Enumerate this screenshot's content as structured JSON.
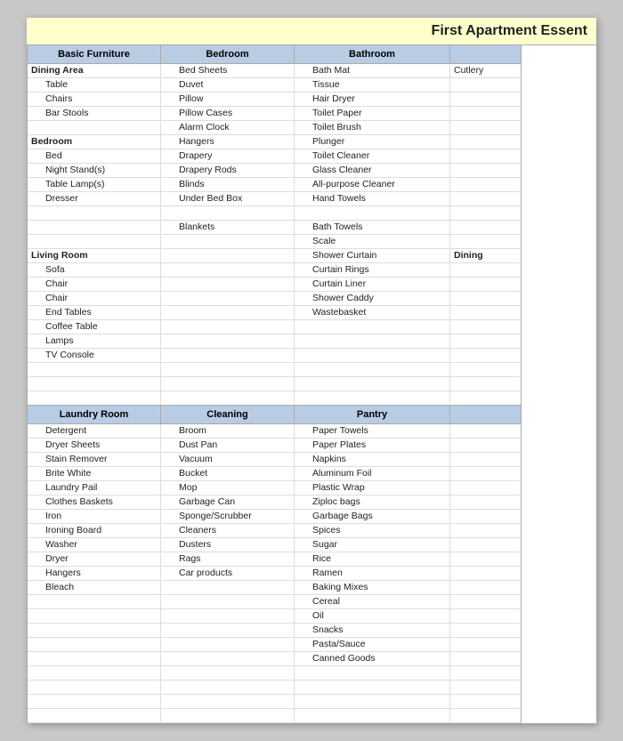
{
  "title": "First Apartment Essent",
  "columns": [
    "Basic Furniture",
    "Bedroom",
    "Bathroom",
    ""
  ],
  "col4_label": "Cutlery",
  "rows": [
    [
      "Dining Area",
      "Bed Sheets",
      "Bath Mat",
      "Cutlery"
    ],
    [
      "   Table",
      "Duvet",
      "Tissue",
      ""
    ],
    [
      "   Chairs",
      "Pillow",
      "Hair Dryer",
      ""
    ],
    [
      "   Bar Stools",
      "Pillow Cases",
      "Toilet Paper",
      ""
    ],
    [
      "",
      "Alarm Clock",
      "Toilet Brush",
      ""
    ],
    [
      "Bedroom",
      "Hangers",
      "Plunger",
      ""
    ],
    [
      "   Bed",
      "Drapery",
      "Toilet Cleaner",
      ""
    ],
    [
      "   Night Stand(s)",
      "Drapery Rods",
      "Glass Cleaner",
      ""
    ],
    [
      "   Table Lamp(s)",
      "Blinds",
      "All-purpose Cleaner",
      ""
    ],
    [
      "   Dresser",
      "Under Bed Box",
      "Hand Towels",
      ""
    ],
    [
      "",
      "",
      "",
      ""
    ],
    [
      "",
      "Blankets",
      "Bath Towels",
      ""
    ],
    [
      "",
      "",
      "Scale",
      ""
    ],
    [
      "Living Room",
      "",
      "Shower Curtain",
      "Dining"
    ],
    [
      "   Sofa",
      "",
      "Curtain Rings",
      ""
    ],
    [
      "   Chair",
      "",
      "Curtain Liner",
      ""
    ],
    [
      "   Chair",
      "",
      "Shower Caddy",
      ""
    ],
    [
      "   End Tables",
      "",
      "Wastebasket",
      ""
    ],
    [
      "   Coffee Table",
      "",
      "",
      ""
    ],
    [
      "   Lamps",
      "",
      "",
      ""
    ],
    [
      "   TV Console",
      "",
      "",
      ""
    ],
    [
      "",
      "",
      "",
      ""
    ],
    [
      "",
      "",
      "",
      ""
    ],
    [
      "",
      "",
      "",
      ""
    ],
    [
      "",
      "",
      "",
      ""
    ]
  ],
  "section2_headers": [
    "Laundry Room",
    "Cleaning",
    "Pantry",
    ""
  ],
  "rows2": [
    [
      "Detergent",
      "Broom",
      "Paper Towels",
      ""
    ],
    [
      "Dryer Sheets",
      "Dust Pan",
      "Paper Plates",
      ""
    ],
    [
      "Stain Remover",
      "Vacuum",
      "Napkins",
      ""
    ],
    [
      "Brite White",
      "Bucket",
      "Aluminum Foil",
      ""
    ],
    [
      "Laundry Pail",
      "Mop",
      "Plastic Wrap",
      ""
    ],
    [
      "Clothes Baskets",
      "Garbage Can",
      "Ziploc bags",
      ""
    ],
    [
      "Iron",
      "Sponge/Scrubber",
      "Garbage Bags",
      ""
    ],
    [
      "Ironing Board",
      "Cleaners",
      "Spices",
      ""
    ],
    [
      "Washer",
      "Dusters",
      "Sugar",
      ""
    ],
    [
      "Dryer",
      "Rags",
      "Rice",
      ""
    ],
    [
      "Hangers",
      "Car products",
      "Ramen",
      ""
    ],
    [
      "Bleach",
      "",
      "Baking Mixes",
      ""
    ],
    [
      "",
      "",
      "Cereal",
      ""
    ],
    [
      "",
      "",
      "Oil",
      ""
    ],
    [
      "",
      "",
      "Snacks",
      ""
    ],
    [
      "",
      "",
      "Pasta/Sauce",
      ""
    ],
    [
      "",
      "",
      "Canned Goods",
      ""
    ],
    [
      "",
      "",
      "",
      ""
    ],
    [
      "",
      "",
      "",
      ""
    ],
    [
      "",
      "",
      "",
      ""
    ],
    [
      "",
      "",
      "",
      ""
    ]
  ]
}
